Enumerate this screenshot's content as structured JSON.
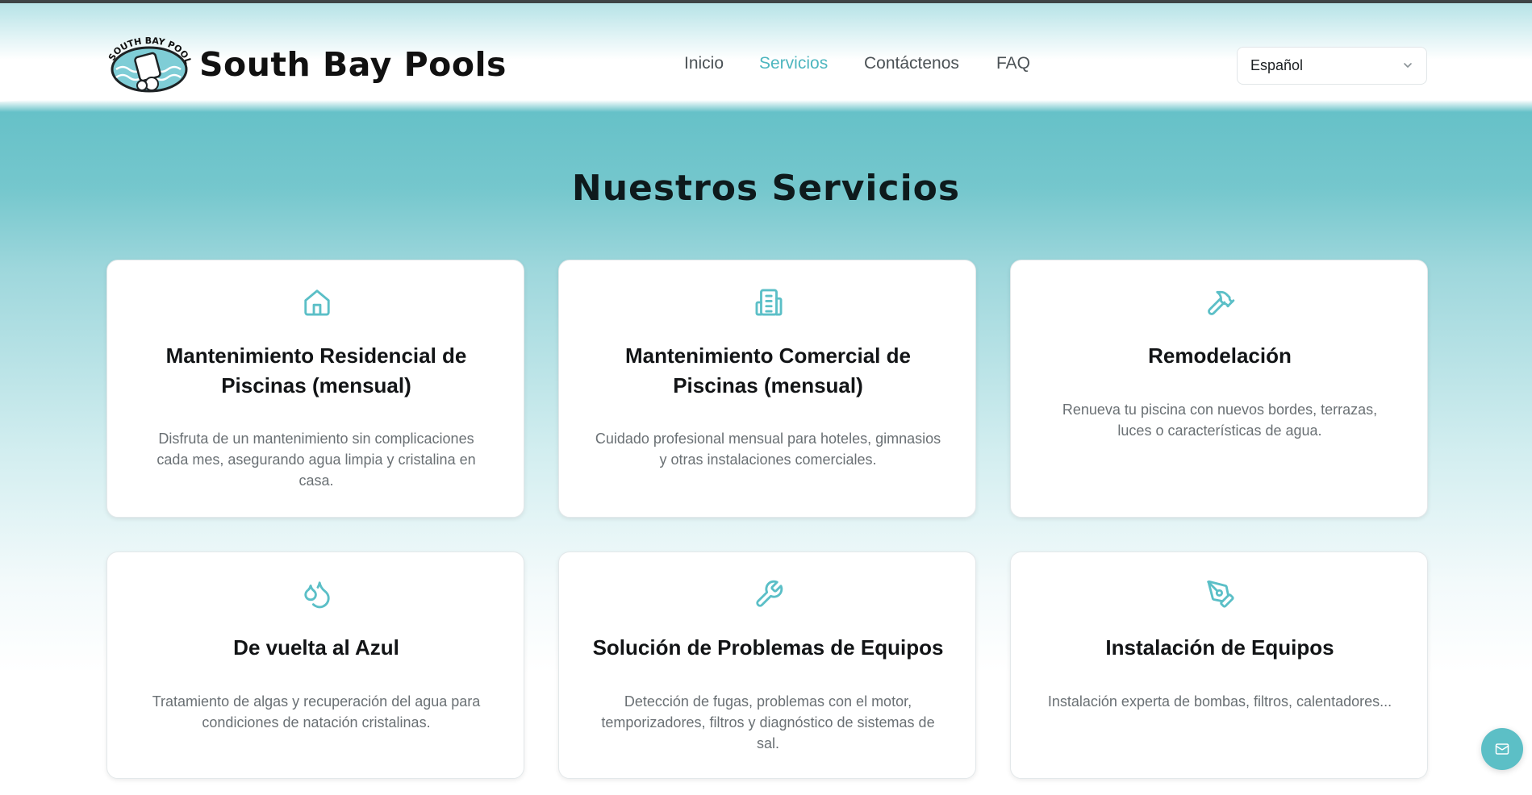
{
  "header": {
    "logo_text": "SOUTH BAY POOLS",
    "brand": "South Bay Pools",
    "nav": [
      {
        "label": "Inicio",
        "active": false
      },
      {
        "label": "Servicios",
        "active": true
      },
      {
        "label": "Contáctenos",
        "active": false
      },
      {
        "label": "FAQ",
        "active": false
      }
    ],
    "language": {
      "selected": "Español"
    }
  },
  "main": {
    "title": "Nuestros Servicios",
    "services": [
      {
        "icon": "home-icon",
        "title": "Mantenimiento Residencial de Piscinas (mensual)",
        "description": "Disfruta de un mantenimiento sin complicaciones cada mes, asegurando agua limpia y cristalina en casa."
      },
      {
        "icon": "building-icon",
        "title": "Mantenimiento Comercial de Piscinas (mensual)",
        "description": "Cuidado profesional mensual para hoteles, gimnasios y otras instalaciones comerciales."
      },
      {
        "icon": "hammer-icon",
        "title": "Remodelación",
        "description": "Renueva tu piscina con nuevos bordes, terrazas, luces o características de agua."
      },
      {
        "icon": "droplets-icon",
        "title": "De vuelta al Azul",
        "description": "Tratamiento de algas y recuperación del agua para condiciones de natación cristalinas."
      },
      {
        "icon": "wrench-icon",
        "title": "Solución de Problemas de Equipos",
        "description": "Detección de fugas, problemas con el motor, temporizadores, filtros y diagnóstico de sistemas de sal."
      },
      {
        "icon": "pen-tool-icon",
        "title": "Instalación de Equipos",
        "description": "Instalación experta de bombas, filtros, calentadores..."
      }
    ]
  },
  "fab": {
    "icon": "mail-icon"
  },
  "colors": {
    "accent": "#4db6bf",
    "hero": "#66c1c8",
    "text": "#121416",
    "muted": "#6a7074"
  }
}
